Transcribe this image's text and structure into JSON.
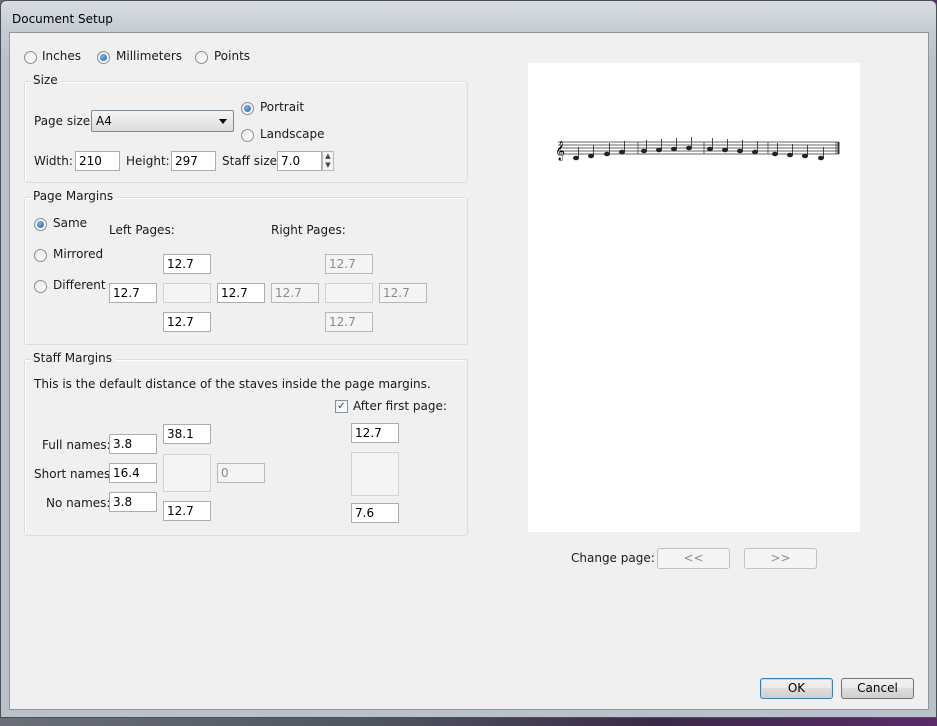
{
  "window": {
    "title": "Document Setup"
  },
  "units": {
    "options": [
      "Inches",
      "Millimeters",
      "Points"
    ],
    "selected": "Millimeters"
  },
  "size": {
    "group_title": "Size",
    "page_size_label": "Page size:",
    "page_size_value": "A4",
    "portrait_label": "Portrait",
    "landscape_label": "Landscape",
    "orientation_selected": "Portrait",
    "width_label": "Width:",
    "width_value": "210",
    "height_label": "Height:",
    "height_value": "297",
    "staff_size_label": "Staff size:",
    "staff_size_value": "7.0"
  },
  "page_margins": {
    "group_title": "Page Margins",
    "same_label": "Same",
    "mirrored_label": "Mirrored",
    "different_label": "Different",
    "selected": "Same",
    "left_pages_label": "Left Pages:",
    "right_pages_label": "Right Pages:",
    "left": {
      "top": "12.7",
      "left": "12.7",
      "right": "12.7",
      "bottom": "12.7"
    },
    "right": {
      "top": "12.7",
      "left": "12.7",
      "right": "12.7",
      "bottom": "12.7"
    }
  },
  "staff_margins": {
    "group_title": "Staff Margins",
    "description": "This is the default distance of the staves inside the page margins.",
    "full_names_label": "Full names:",
    "full_names_value": "3.8",
    "short_names_label": "Short names:",
    "short_names_value": "16.4",
    "no_names_label": "No names:",
    "no_names_value": "3.8",
    "top_value": "38.1",
    "right_value": "0",
    "bottom_value": "12.7",
    "after_first_page_label": "After first page:",
    "after_first_page_checked": true,
    "after_top_value": "12.7",
    "after_bottom_value": "7.6"
  },
  "preview": {
    "change_page_label": "Change page:",
    "prev_label": "<<",
    "next_label": ">>"
  },
  "buttons": {
    "ok_label": "OK",
    "cancel_label": "Cancel"
  },
  "check_glyph": "✓"
}
